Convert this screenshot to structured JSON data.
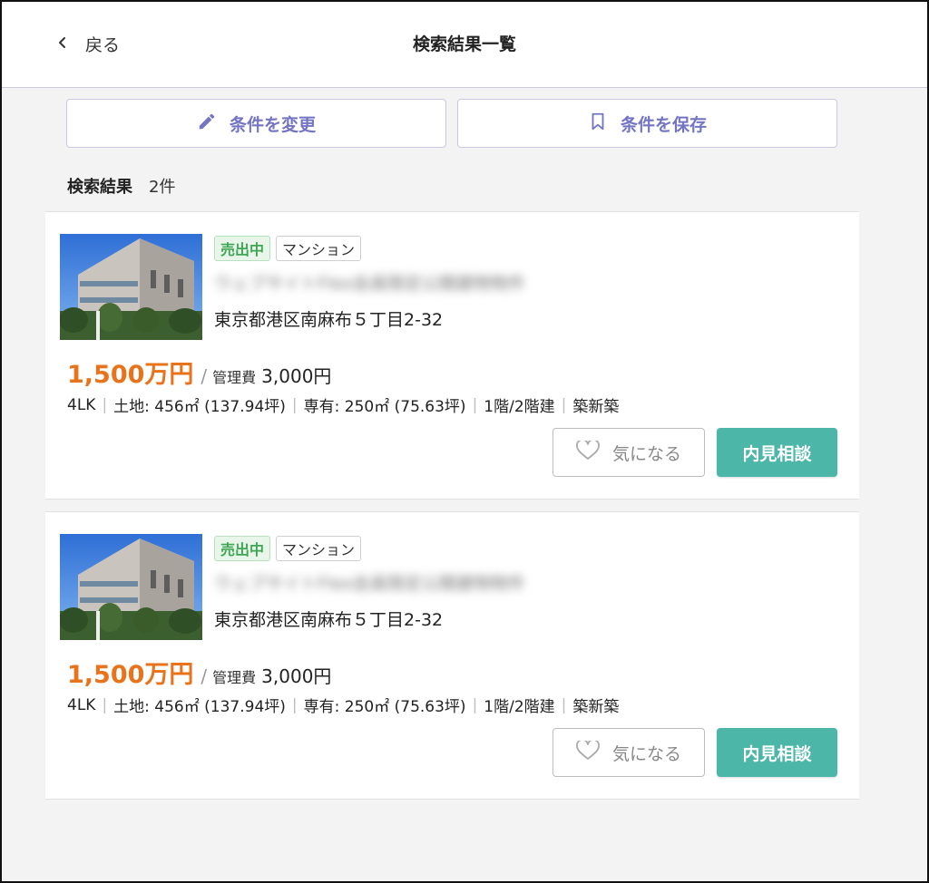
{
  "header": {
    "back_label": "戻る",
    "title": "検索結果一覧"
  },
  "actions": {
    "change_label": "条件を変更",
    "save_label": "条件を保存"
  },
  "results": {
    "label": "検索結果",
    "count": "2件"
  },
  "listings": [
    {
      "status_badge": "売出中",
      "type_badge": "マンション",
      "name_blurred": "ウェブサイトFlex会員限定公開建物物件",
      "address": "東京都港区南麻布５丁目2-32",
      "price": "1,500万円",
      "fee_label": "管理費",
      "fee_value": "3,000円",
      "specs": [
        "4LK",
        "土地: 456㎡ (137.94坪)",
        "専有: 250㎡ (75.63坪)",
        "1階/2階建",
        "築新築"
      ],
      "favorite_label": "気になる",
      "consult_label": "内見相談"
    },
    {
      "status_badge": "売出中",
      "type_badge": "マンション",
      "name_blurred": "ウェブサイトFlex会員限定公開建物物件",
      "address": "東京都港区南麻布５丁目2-32",
      "price": "1,500万円",
      "fee_label": "管理費",
      "fee_value": "3,000円",
      "specs": [
        "4LK",
        "土地: 456㎡ (137.94坪)",
        "専有: 250㎡ (75.63坪)",
        "1階/2階建",
        "築新築"
      ],
      "favorite_label": "気になる",
      "consult_label": "内見相談"
    }
  ],
  "colors": {
    "accent_purple": "#7474c4",
    "price_orange": "#e8731a",
    "sale_green": "#3fa655",
    "consult_teal": "#4cb6a9"
  },
  "icons": {
    "back": "chevron-left-icon",
    "change": "pencil-icon",
    "save": "bookmark-icon",
    "favorite": "heart-icon"
  }
}
